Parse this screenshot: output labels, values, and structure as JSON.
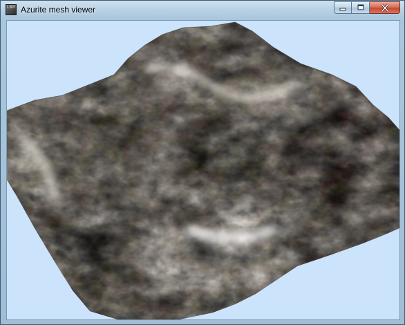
{
  "window": {
    "title": "Azurite mesh viewer",
    "icon": "app-icon",
    "icon_text": "L3DT"
  },
  "caption_buttons": [
    {
      "name": "minimize-button",
      "icon": "minimize-icon"
    },
    {
      "name": "maximize-button",
      "icon": "maximize-icon"
    },
    {
      "name": "close-button",
      "icon": "close-icon"
    }
  ],
  "viewport": {
    "background_color": "#cce3fc",
    "content": "terrain-mesh"
  },
  "colors": {
    "close_button": "#c24931",
    "titlebar": "#b5cfe3"
  }
}
